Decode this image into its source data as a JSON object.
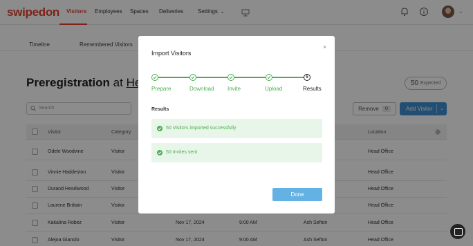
{
  "app": {
    "logo": "swipedon"
  },
  "nav": {
    "items": [
      "Visitors",
      "Employees",
      "Spaces",
      "Deliveries",
      "Settings"
    ]
  },
  "subtabs": [
    "Timeline",
    "Remembered Visitors"
  ],
  "page": {
    "title_main": "Preregistration",
    "title_at": "at",
    "title_location": "Head",
    "expected_count": "50",
    "expected_label": "Expected",
    "search_placeholder": "Search",
    "remove_label": "Remove",
    "remove_count": "0",
    "add_label": "Add Visitor"
  },
  "table": {
    "headers": {
      "visitor": "Visitor",
      "category": "Category",
      "location": "Location"
    },
    "rows": [
      {
        "name": "Odele Woodvine",
        "category": "Visitor",
        "date": "",
        "time": "",
        "host": "",
        "location": "Head Office"
      },
      {
        "name": "Vinnie Haddeston",
        "category": "Visitor",
        "date": "",
        "time": "",
        "host": "",
        "location": "Head Office"
      },
      {
        "name": "Durand Hesélwood",
        "category": "Visitor",
        "date": "",
        "time": "",
        "host": "",
        "location": "Head Office"
      },
      {
        "name": "Laurene Brittain",
        "category": "Visitor",
        "date": "",
        "time": "",
        "host": "",
        "location": "Head Office"
      },
      {
        "name": "Kakalina Robez",
        "category": "Visitor",
        "date": "Nov 17, 2024",
        "time": "9:00 AM",
        "host": "Ash Sefton",
        "location": "Head Office"
      },
      {
        "name": "Alejoa Gianolo",
        "category": "Visitor",
        "date": "Nov 17, 2024",
        "time": "9:00 AM",
        "host": "Ash Sefton",
        "location": "Head Office"
      }
    ]
  },
  "modal": {
    "title": "Import Visitors",
    "close": "×",
    "steps": [
      {
        "label": "Prepare",
        "state": "done"
      },
      {
        "label": "Download",
        "state": "done"
      },
      {
        "label": "Invite",
        "state": "done"
      },
      {
        "label": "Upload",
        "state": "done"
      },
      {
        "label": "Results",
        "state": "current",
        "number": "5"
      }
    ],
    "results_label": "Results",
    "results": [
      "50 Visitors imported successfully",
      "50 Invites sent"
    ],
    "done_label": "Done"
  },
  "colors": {
    "brand": "#e0402c",
    "accent": "#3d8fcf",
    "success": "#4caf50",
    "done_button": "#64b2e3"
  }
}
